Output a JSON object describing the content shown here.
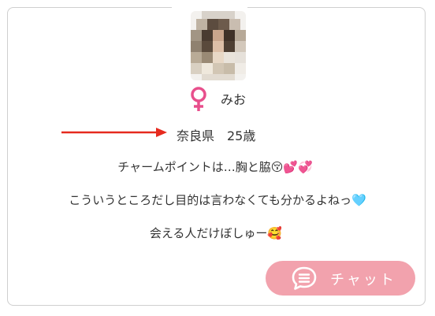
{
  "profile": {
    "name": "みお",
    "location": "奈良県　25歳",
    "gender_icon": "female-symbol-icon",
    "avatar": "pixelated-profile-photo"
  },
  "bio_lines": [
    "チャームポイントは…胸と脇😚💕💞",
    "こういうところだし目的は言わなくても分かるよねっ🩵",
    "会える人だけぼしゅー🥰"
  ],
  "chat_button": {
    "label": "チャット",
    "icon": "chat-bubble-icon"
  },
  "colors": {
    "accent_pink": "#e84f8c",
    "button_pink": "#f2a2ad",
    "arrow_red": "#e62a1e"
  }
}
